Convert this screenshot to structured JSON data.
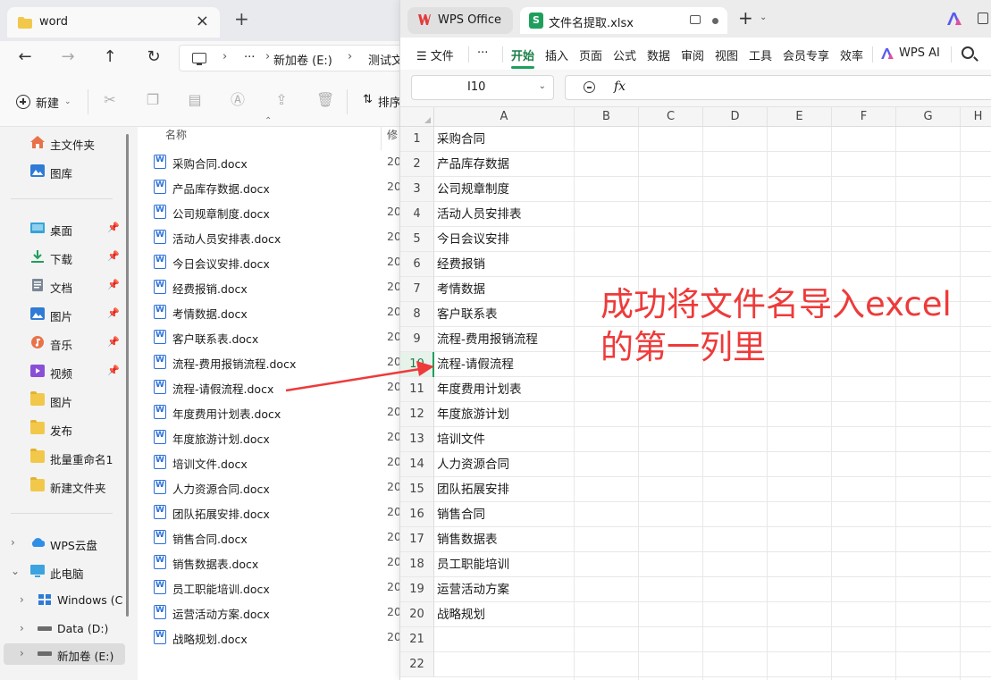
{
  "explorer": {
    "tab_title": "word",
    "breadcrumb": [
      "新加卷 (E:)",
      "测试文"
    ],
    "toolbar": {
      "new_label": "新建",
      "sort_label": "排序"
    },
    "sidebar": {
      "quick": [
        {
          "label": "主文件夹",
          "icon": "home-icon"
        },
        {
          "label": "图库",
          "icon": "gallery-icon"
        }
      ],
      "pinned": [
        {
          "label": "桌面",
          "icon": "desktop-icon",
          "pinned": true
        },
        {
          "label": "下载",
          "icon": "download-icon",
          "pinned": true
        },
        {
          "label": "文档",
          "icon": "document-icon",
          "pinned": true
        },
        {
          "label": "图片",
          "icon": "picture-icon",
          "pinned": true
        },
        {
          "label": "音乐",
          "icon": "music-icon",
          "pinned": true
        },
        {
          "label": "视频",
          "icon": "video-icon",
          "pinned": true
        },
        {
          "label": "图片",
          "icon": "folder-icon",
          "pinned": false
        },
        {
          "label": "发布",
          "icon": "folder-icon",
          "pinned": false
        },
        {
          "label": "批量重命名1",
          "icon": "folder-icon",
          "pinned": false
        },
        {
          "label": "新建文件夹",
          "icon": "folder-icon",
          "pinned": false
        }
      ],
      "tree": [
        {
          "label": "WPS云盘",
          "icon": "cloud-icon"
        },
        {
          "label": "此电脑",
          "icon": "computer-icon"
        },
        {
          "label": "Windows (C",
          "icon": "windows-drive-icon"
        },
        {
          "label": "Data (D:)",
          "icon": "drive-icon"
        },
        {
          "label": "新加卷 (E:)",
          "icon": "drive-icon"
        }
      ]
    },
    "columns": {
      "name": "名称",
      "modified": "修"
    },
    "files": [
      {
        "name": "采购合同.docx",
        "date": "20"
      },
      {
        "name": "产品库存数据.docx",
        "date": "20"
      },
      {
        "name": "公司规章制度.docx",
        "date": "20"
      },
      {
        "name": "活动人员安排表.docx",
        "date": "20"
      },
      {
        "name": "今日会议安排.docx",
        "date": "20"
      },
      {
        "name": "经费报销.docx",
        "date": "20"
      },
      {
        "name": "考情数据.docx",
        "date": "20"
      },
      {
        "name": "客户联系表.docx",
        "date": "20"
      },
      {
        "name": "流程-费用报销流程.docx",
        "date": "20"
      },
      {
        "name": "流程-请假流程.docx",
        "date": "20"
      },
      {
        "name": "年度费用计划表.docx",
        "date": "20"
      },
      {
        "name": "年度旅游计划.docx",
        "date": "20"
      },
      {
        "name": "培训文件.docx",
        "date": "20"
      },
      {
        "name": "人力资源合同.docx",
        "date": "20"
      },
      {
        "name": "团队拓展安排.docx",
        "date": "20"
      },
      {
        "name": "销售合同.docx",
        "date": "20"
      },
      {
        "name": "销售数据表.docx",
        "date": "20"
      },
      {
        "name": "员工职能培训.docx",
        "date": "20"
      },
      {
        "name": "运营活动方案.docx",
        "date": "20"
      },
      {
        "name": "战略规划.docx",
        "date": "20"
      }
    ]
  },
  "wps": {
    "tab1_title": "WPS Office",
    "tab2_title": "文件名提取.xlsx",
    "menu": {
      "file": "文件",
      "more": "···",
      "items": [
        "开始",
        "插入",
        "页面",
        "公式",
        "数据",
        "审阅",
        "视图",
        "工具",
        "会员专享",
        "效率"
      ],
      "ai": "WPS AI"
    },
    "name_box": "I10",
    "fx": "fx",
    "columns": [
      "A",
      "B",
      "C",
      "D",
      "E",
      "F",
      "G",
      "H"
    ],
    "rows": [
      "1",
      "2",
      "3",
      "4",
      "5",
      "6",
      "7",
      "8",
      "9",
      "10",
      "11",
      "12",
      "13",
      "14",
      "15",
      "16",
      "17",
      "18",
      "19",
      "20",
      "21",
      "22"
    ],
    "selected_row": "10",
    "cells": [
      "采购合同",
      "产品库存数据",
      "公司规章制度",
      "活动人员安排表",
      "今日会议安排",
      "经费报销",
      "考情数据",
      "客户联系表",
      "流程-费用报销流程",
      "流程-请假流程",
      "年度费用计划表",
      "年度旅游计划",
      "培训文件",
      "人力资源合同",
      "团队拓展安排",
      "销售合同",
      "销售数据表",
      "员工职能培训",
      "运营活动方案",
      "战略规划"
    ]
  },
  "annotation": {
    "line1": "成功将文件名导入excel",
    "line2": "的第一列里",
    "color": "#ee3a3a"
  }
}
